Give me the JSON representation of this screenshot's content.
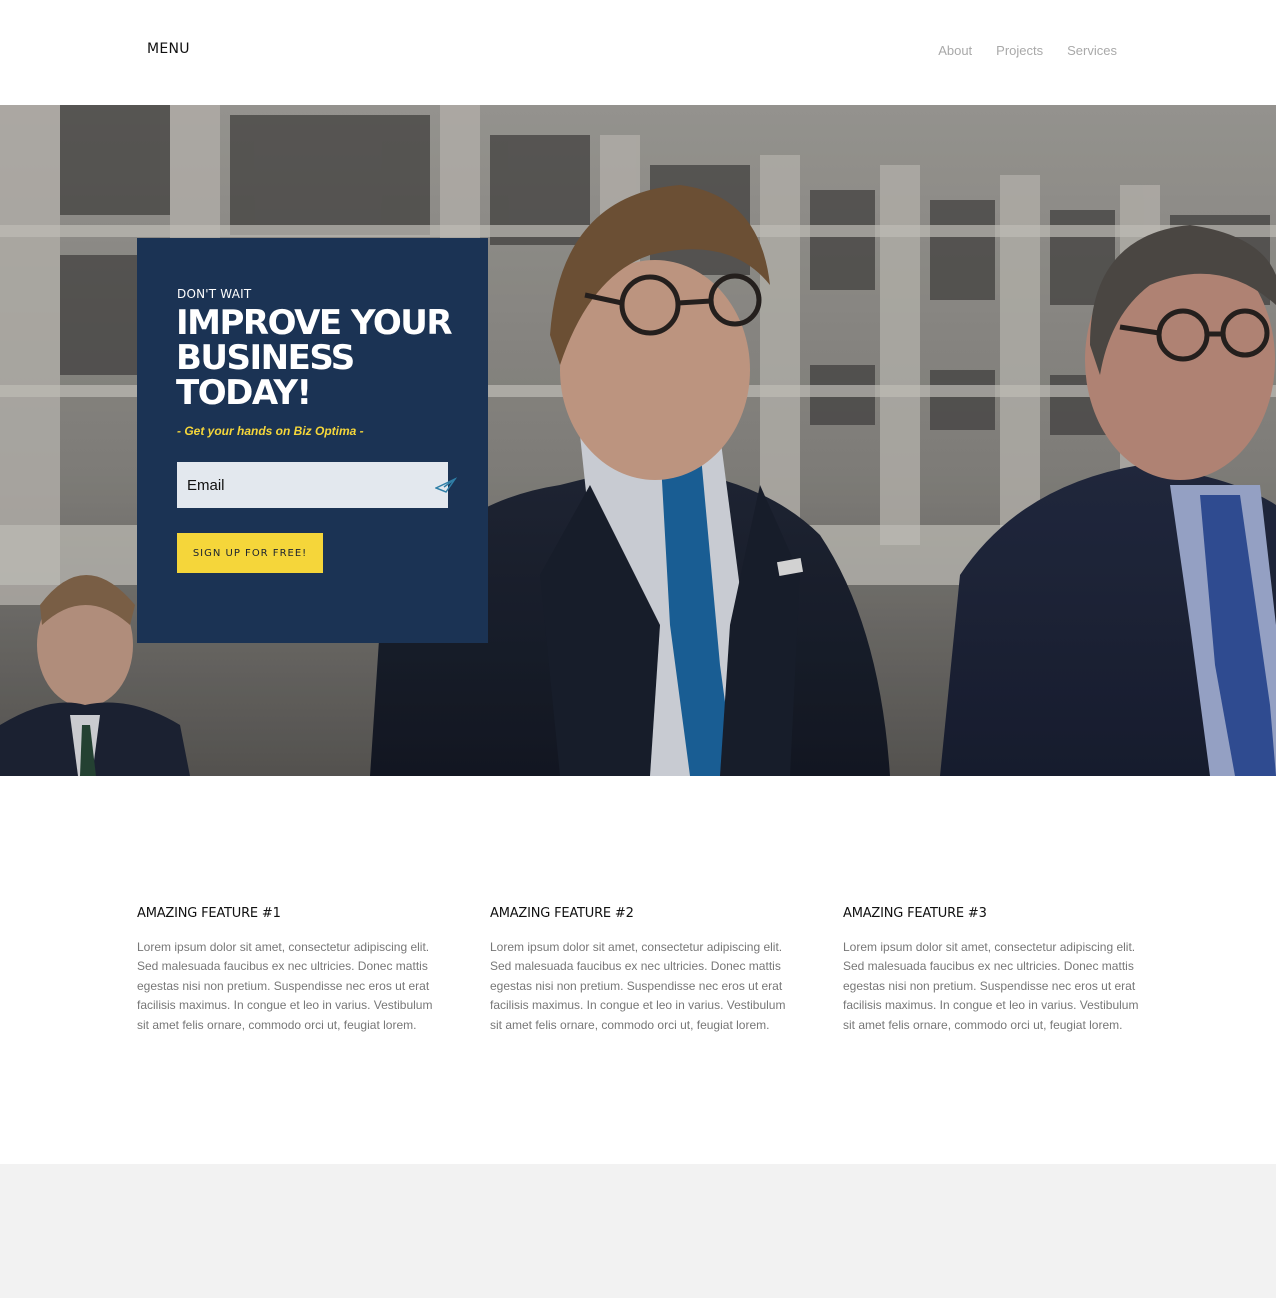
{
  "header": {
    "menu_label": "MENU",
    "nav": [
      "About",
      "Projects",
      "Services"
    ]
  },
  "hero": {
    "image": "business-men-photo",
    "eyebrow": "DON'T WAIT",
    "headline": "IMPROVE YOUR BUSINESS TODAY!",
    "tagline": "- Get your hands on Biz Optima -",
    "email_placeholder": "Email",
    "send_icon": "paper-plane-icon",
    "cta_label": "SIGN UP FOR FREE!"
  },
  "features": [
    {
      "title": "AMAZING FEATURE #1",
      "body": "Lorem ipsum dolor sit amet, consectetur adipiscing elit. Sed malesuada faucibus ex nec ultricies. Donec mattis egestas nisi non pretium. Suspendisse nec eros ut erat facilisis maximus. In congue et leo in varius. Vestibulum sit amet felis ornare, commodo orci ut, feugiat lorem."
    },
    {
      "title": "AMAZING FEATURE #2",
      "body": "Lorem ipsum dolor sit amet, consectetur adipiscing elit. Sed malesuada faucibus ex nec ultricies. Donec mattis egestas nisi non pretium. Suspendisse nec eros ut erat facilisis maximus. In congue et leo in varius. Vestibulum sit amet felis ornare, commodo orci ut, feugiat lorem."
    },
    {
      "title": "AMAZING FEATURE #3",
      "body": "Lorem ipsum dolor sit amet, consectetur adipiscing elit. Sed malesuada faucibus ex nec ultricies. Donec mattis egestas nisi non pretium. Suspendisse nec eros ut erat facilisis maximus. In congue et leo in varius. Vestibulum sit amet felis ornare, commodo orci ut, feugiat lorem."
    }
  ],
  "colors": {
    "card_bg": "#1b3354",
    "accent_yellow": "#f5d63a",
    "nav_gray": "#a9a9a9",
    "body_gray": "#777777",
    "footer_bg": "#f2f2f2"
  }
}
